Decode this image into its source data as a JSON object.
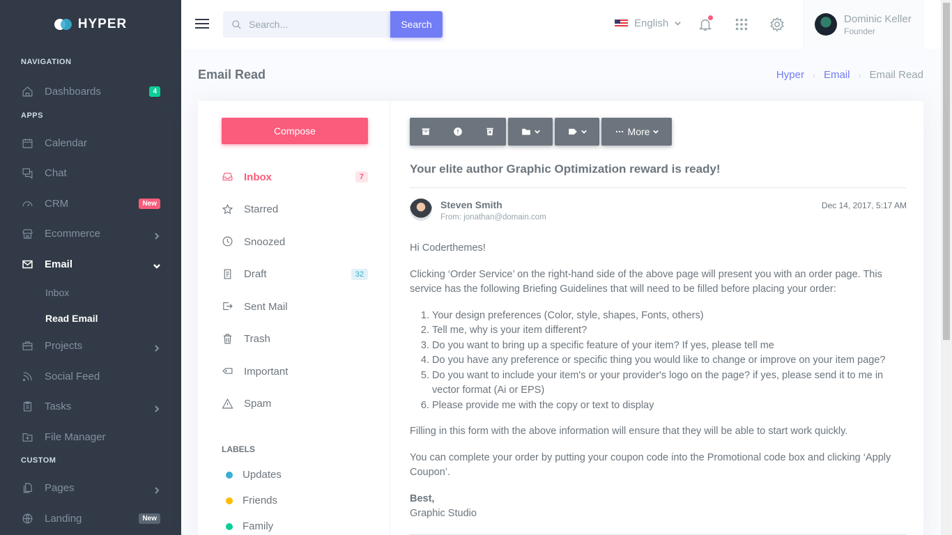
{
  "brand": {
    "name": "HYPER"
  },
  "sidebar": {
    "sections": {
      "navigation": "NAVIGATION",
      "apps": "APPS",
      "custom": "CUSTOM"
    },
    "dashboards": {
      "label": "Dashboards",
      "badge": "4"
    },
    "calendar": "Calendar",
    "chat": "Chat",
    "crm": {
      "label": "CRM",
      "badge": "New"
    },
    "ecommerce": "Ecommerce",
    "email": {
      "label": "Email",
      "sub": [
        "Inbox",
        "Read Email"
      ]
    },
    "projects": "Projects",
    "social": "Social Feed",
    "tasks": "Tasks",
    "files": "File Manager",
    "pages": "Pages",
    "landing": {
      "label": "Landing",
      "badge": "New"
    }
  },
  "topbar": {
    "search_placeholder": "Search...",
    "search_button": "Search",
    "language": "English",
    "user": {
      "name": "Dominic Keller",
      "role": "Founder"
    }
  },
  "page": {
    "title": "Email Read",
    "breadcrumb": [
      "Hyper",
      "Email",
      "Email Read"
    ]
  },
  "mailbox": {
    "compose": "Compose",
    "folders": [
      {
        "label": "Inbox",
        "count": "7"
      },
      {
        "label": "Starred"
      },
      {
        "label": "Snoozed"
      },
      {
        "label": "Draft",
        "count": "32"
      },
      {
        "label": "Sent Mail"
      },
      {
        "label": "Trash"
      },
      {
        "label": "Important"
      },
      {
        "label": "Spam"
      }
    ],
    "labels_title": "LABELS",
    "labels": [
      {
        "label": "Updates",
        "color": "#39afd1"
      },
      {
        "label": "Friends",
        "color": "#ffbc00"
      },
      {
        "label": "Family",
        "color": "#0acf97"
      }
    ]
  },
  "email": {
    "more_label": "More",
    "subject": "Your elite author Graphic Optimization reward is ready!",
    "sender": "Steven Smith",
    "from": "From: jonathan@domain.com",
    "date": "Dec 14, 2017, 5:17 AM",
    "greeting": "Hi Coderthemes!",
    "intro": "Clicking ‘Order Service’ on the right-hand side of the above page will present you with an order page. This service has the following Briefing Guidelines that will need to be filled before placing your order:",
    "items": [
      "Your design preferences (Color, style, shapes, Fonts, others)",
      "Tell me, why is your item different?",
      "Do you want to bring up a specific feature of your item? If yes, please tell me",
      "Do you have any preference or specific thing you would like to change or improve on your item page?",
      "Do you want to include your item's or your provider's logo on the page? if yes, please send it to me in vector format (Ai or EPS)",
      "Please provide me with the copy or text to display"
    ],
    "p2": "Filling in this form with the above information will ensure that they will be able to start work quickly.",
    "p3": "You can complete your order by putting your coupon code into the Promotional code box and clicking ‘Apply Coupon’.",
    "sign_off": "Best,",
    "signature": "Graphic Studio"
  }
}
